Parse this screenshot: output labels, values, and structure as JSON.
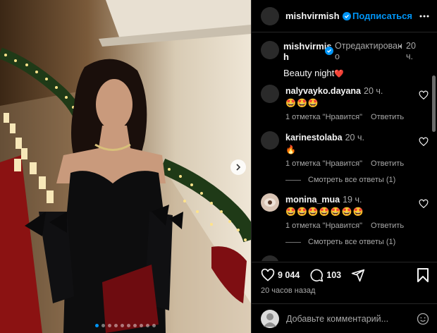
{
  "post": {
    "author": "mishvirmish",
    "follow_label": "Подписаться",
    "more_icon": "more-horizontal-icon",
    "accent": "#0095f6"
  },
  "caption": {
    "user_line1": "mishvirmis",
    "user_line2": "h",
    "edited": "Отредактирован",
    "edited2": "о",
    "time": "20",
    "time2": "ч.",
    "dot": "•",
    "text": "Beauty night",
    "emoji": "❤️"
  },
  "comments": [
    {
      "user": "nalyvayko.dayana",
      "time": "20 ч.",
      "text": "🤩🤩🤩",
      "likes": "1 отметка \"Нравится\"",
      "reply": "Ответить"
    },
    {
      "user": "karinestolaba",
      "time": "20 ч.",
      "text": "🔥",
      "likes": "1 отметка \"Нравится\"",
      "reply": "Ответить",
      "view_replies": "Смотреть все ответы (1)"
    },
    {
      "user": "monina_mua",
      "time": "19 ч.",
      "text": "🤩🤩🤩🤩🤩🤩🤩",
      "likes": "1 отметка \"Нравится\"",
      "reply": "Ответить",
      "view_replies": "Смотреть все ответы (1)"
    }
  ],
  "actions": {
    "likes": "9 044",
    "comments": "103",
    "time": "20 часов назад"
  },
  "add_comment": {
    "placeholder": "Добавьте комментарий..."
  },
  "carousel": {
    "total": 10,
    "active": 1
  }
}
